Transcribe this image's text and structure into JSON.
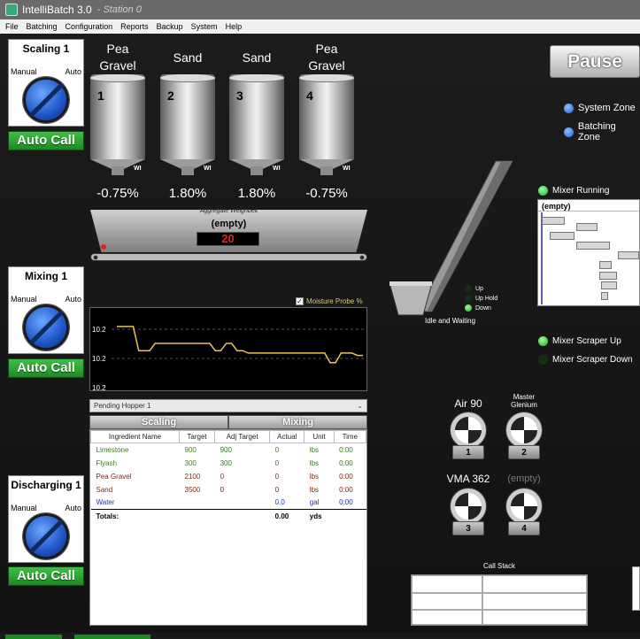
{
  "window": {
    "title": "IntelliBatch 3.0",
    "station": "- Station 0"
  },
  "menu": [
    "File",
    "Batching",
    "Configuration",
    "Reports",
    "Backup",
    "System",
    "Help"
  ],
  "mode_boxes": [
    {
      "title": "Scaling 1",
      "manual": "Manual",
      "auto": "Auto",
      "button": "Auto Call"
    },
    {
      "title": "Mixing 1",
      "manual": "Manual",
      "auto": "Auto",
      "button": "Auto Call"
    },
    {
      "title": "Discharging 1",
      "manual": "Manual",
      "auto": "Auto",
      "button": "Auto Call"
    }
  ],
  "hoppers": [
    {
      "label": "Pea Gravel",
      "number": "1",
      "wi": "WI",
      "percent": "-0.75%"
    },
    {
      "label": "Sand",
      "number": "2",
      "wi": "WI",
      "percent": "1.80%"
    },
    {
      "label": "Sand",
      "number": "3",
      "wi": "WI",
      "percent": "1.80%"
    },
    {
      "label": "Pea Gravel",
      "number": "4",
      "wi": "WI",
      "percent": "-0.75%"
    }
  ],
  "weighbelt": {
    "title": "Aggregate Weighbelt",
    "label": "(empty)",
    "display": "20"
  },
  "moisture": {
    "checkbox_label": "Moisture Probe %",
    "checked": true,
    "y_labels": [
      "10.2",
      "10.2",
      "10.2"
    ],
    "trace": [
      10.26,
      10.26,
      10.26,
      10.26,
      10.16,
      10.16,
      10.16,
      10.19,
      10.19,
      10.19,
      10.19,
      10.19,
      10.19,
      10.19,
      10.19,
      10.19,
      10.19,
      10.19,
      10.16,
      10.16,
      10.19,
      10.19,
      10.16,
      10.16,
      10.15,
      10.15,
      10.15,
      10.15,
      10.15,
      10.15,
      10.15,
      10.15,
      10.15,
      10.15,
      10.15,
      10.15,
      10.15,
      10.15,
      10.15,
      10.11,
      10.11,
      10.15,
      10.15,
      10.15,
      10.14,
      10.14
    ]
  },
  "pending": {
    "value": "Pending Hopper 1"
  },
  "tabs": [
    "Scaling",
    "Mixing"
  ],
  "table": {
    "headers": [
      "Ingredient Name",
      "Target",
      "Adj Target",
      "Actual",
      "Unit",
      "Time"
    ],
    "rows": [
      {
        "name": "Limestone",
        "target": "900",
        "adj": "900",
        "actual": "0",
        "unit": "lbs",
        "time": "0:00",
        "color": "#3c7a28"
      },
      {
        "name": "Flyash",
        "target": "300",
        "adj": "300",
        "actual": "0",
        "unit": "lbs",
        "time": "0:00",
        "color": "#3c7a28"
      },
      {
        "name": "Pea Gravel",
        "target": "2100",
        "adj": "0",
        "actual": "0",
        "unit": "lbs",
        "time": "0:00",
        "color": "#7a2a10"
      },
      {
        "name": "Sand",
        "target": "3500",
        "adj": "0",
        "actual": "0",
        "unit": "lbs",
        "time": "0:00",
        "color": "#7a2a10"
      },
      {
        "name": "Water",
        "target": "",
        "adj": "",
        "actual": "0.0",
        "unit": "gal",
        "time": "0:00",
        "color": "#1e2fd0"
      }
    ],
    "totals": {
      "label": "Totals:",
      "actual": "0.00",
      "unit": "yds"
    }
  },
  "conveyor": {
    "status": "Idle and Waiting",
    "indicators": [
      "Up",
      "Up Hold",
      "Down"
    ]
  },
  "pause_button": "Pause",
  "zones": [
    "System Zone",
    "Batching Zone"
  ],
  "mixer": {
    "running": "Mixer Running",
    "gantt_header": "(empty)",
    "scraper_up": "Mixer Scraper Up",
    "scraper_down": "Mixer Scraper Down"
  },
  "pumps": [
    {
      "label": "Air 90",
      "number": "1"
    },
    {
      "label": "Master Glenium",
      "number": "2"
    },
    {
      "label": "VMA 362",
      "number": "3"
    },
    {
      "label": "(empty)",
      "number": "4"
    }
  ],
  "call_stack": {
    "title": "Call Stack"
  }
}
